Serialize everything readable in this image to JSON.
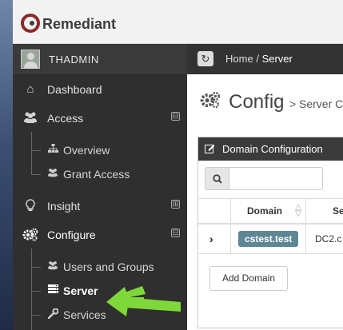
{
  "app": {
    "brand": "Remediant"
  },
  "user": {
    "name": "THADMIN"
  },
  "sidebar": {
    "dashboard": "Dashboard",
    "access": "Access",
    "access_children": [
      "Overview",
      "Grant Access"
    ],
    "insight": "Insight",
    "configure": "Configure",
    "configure_children": [
      "Users and Groups",
      "Server",
      "Services"
    ],
    "collapse_symbol": "⊟",
    "expand_symbol": "⊞"
  },
  "breadcrumb": {
    "home": "Home",
    "separator": "/",
    "current": "Server"
  },
  "page": {
    "title": "Config",
    "subtitle": "> Server Co"
  },
  "panel": {
    "title": "Domain Configuration",
    "search": {
      "placeholder": "",
      "value": ""
    },
    "columns": [
      "Domain",
      "Se"
    ],
    "rows": [
      {
        "domain": "cstest.test",
        "server": "DC2.c"
      }
    ],
    "add_button": "Add Domain"
  },
  "colors": {
    "badge": "#5e8796",
    "annotation_arrow": "#7fd83a",
    "sidebar_bg": "#2f2f2f"
  },
  "icons": [
    "remediant-logo-icon",
    "home-icon",
    "users-icon",
    "sitemap-icon",
    "lightbulb-icon",
    "cogs-icon",
    "server-icon",
    "wrench-icon",
    "refresh-icon",
    "edit-icon",
    "search-icon",
    "sort-icon",
    "chevron-right-icon"
  ]
}
